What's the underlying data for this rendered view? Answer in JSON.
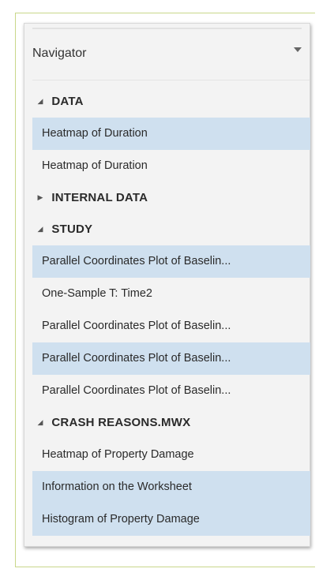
{
  "navigator": {
    "title": "Navigator",
    "dropdown_icon": "chevron-down-icon",
    "colors": {
      "selected_row": "#cfe0ef",
      "panel_background": "#f3f3f3",
      "frame_border": "#c9d78a"
    },
    "sections": [
      {
        "label": "DATA",
        "expanded": true,
        "toggle": "◢",
        "items": [
          {
            "label": "Heatmap of Duration",
            "selected": true
          },
          {
            "label": "Heatmap of Duration",
            "selected": false
          }
        ]
      },
      {
        "label": "INTERNAL DATA",
        "expanded": false,
        "toggle": "▶",
        "items": []
      },
      {
        "label": "STUDY",
        "expanded": true,
        "toggle": "◢",
        "items": [
          {
            "label": "Parallel Coordinates Plot of Baselin...",
            "selected": true
          },
          {
            "label": "One-Sample T: Time2",
            "selected": false
          },
          {
            "label": "Parallel Coordinates Plot of Baselin...",
            "selected": false
          },
          {
            "label": "Parallel Coordinates Plot of Baselin...",
            "selected": true
          },
          {
            "label": "Parallel Coordinates Plot of Baselin...",
            "selected": false
          }
        ]
      },
      {
        "label": "CRASH REASONS.MWX",
        "expanded": true,
        "toggle": "◢",
        "items": [
          {
            "label": "Heatmap of Property Damage",
            "selected": false
          },
          {
            "label": "Information on the Worksheet",
            "selected": true
          },
          {
            "label": "Histogram of Property Damage",
            "selected": true
          }
        ]
      }
    ]
  }
}
